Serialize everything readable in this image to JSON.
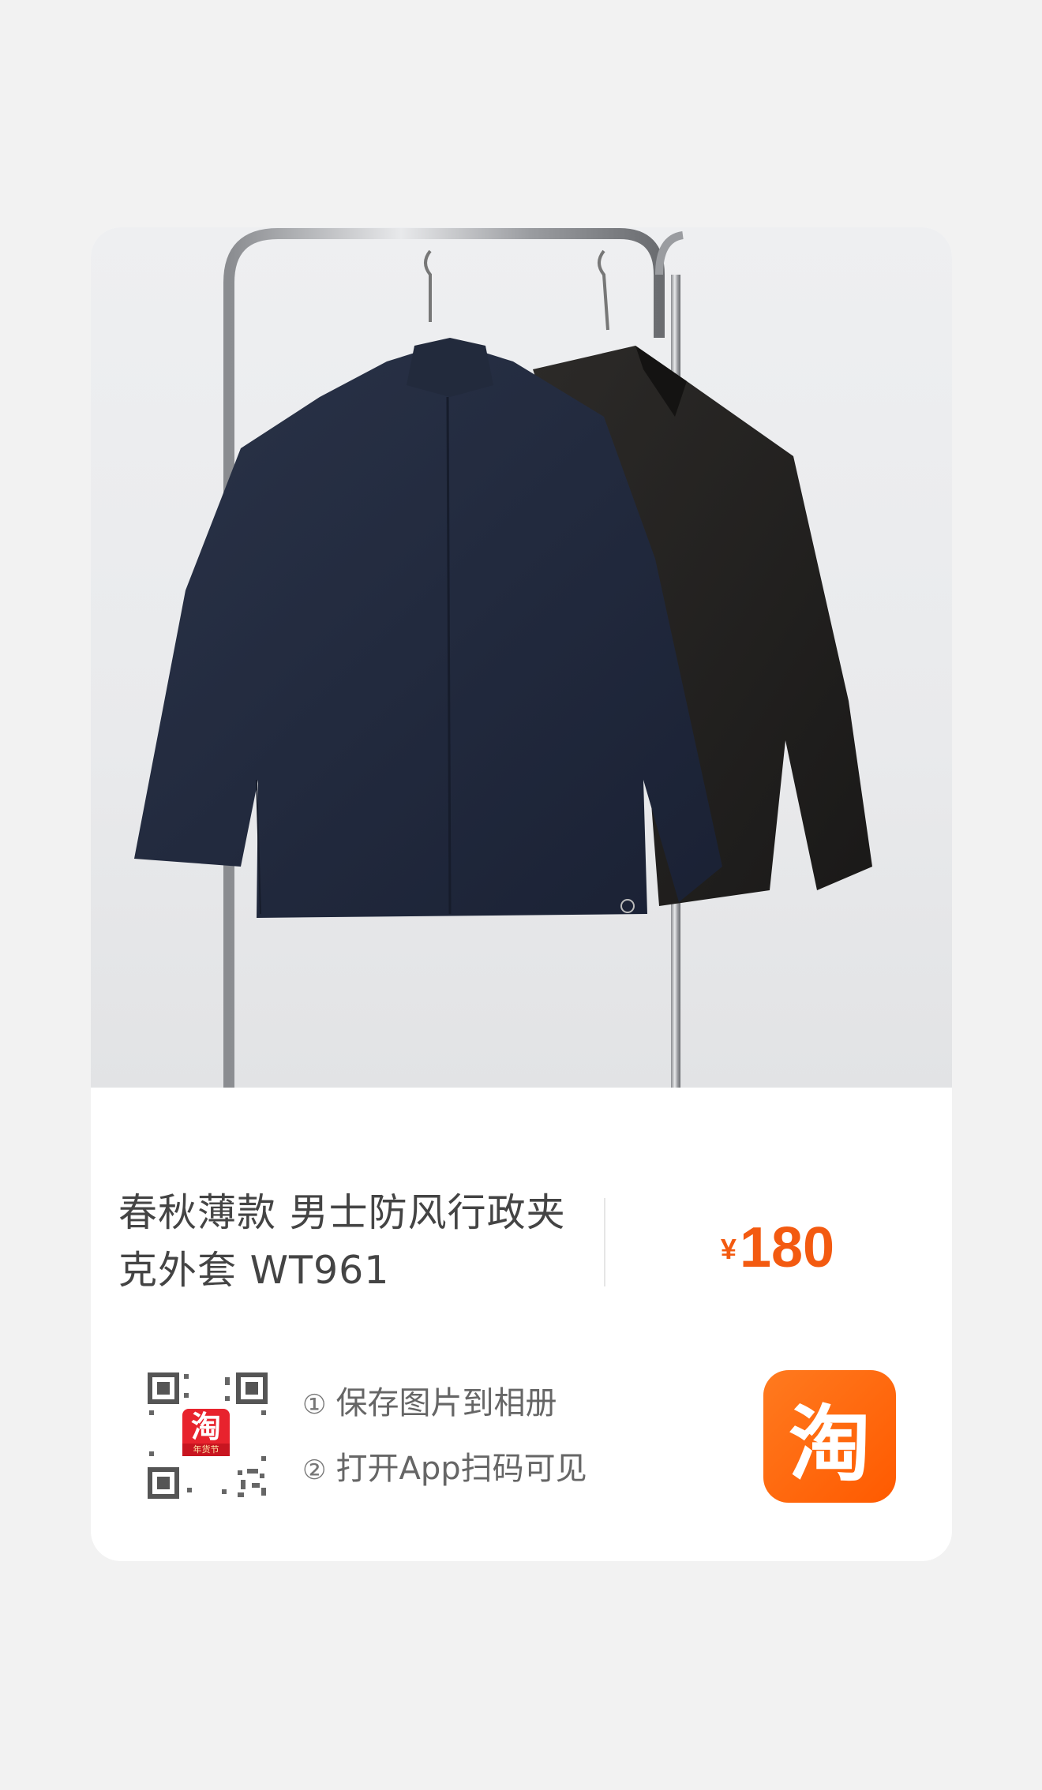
{
  "product": {
    "title_line1": "春秋薄款 男士防风行政夹",
    "title_line2": "克外套 WT961",
    "currency": "¥",
    "price": "180"
  },
  "instructions": {
    "step1_num": "①",
    "step1_text": "保存图片到相册",
    "step2_num": "②",
    "step2_text": "打开App扫码可见"
  },
  "qr": {
    "badge_char": "淘",
    "badge_caption": "年货节"
  },
  "app_icon": {
    "glyph": "淘"
  },
  "colors": {
    "price": "#f35a10",
    "brand": "#ff5a00",
    "background": "#f2f2f2"
  },
  "icons": [
    "qr-code-icon",
    "taobao-app-icon"
  ]
}
